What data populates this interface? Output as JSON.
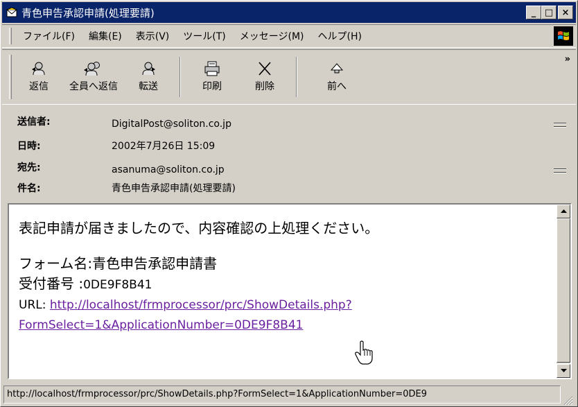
{
  "window": {
    "title": "青色申告承認申請(処理要請)"
  },
  "window_buttons": {
    "minimize": "_",
    "maximize": "□",
    "close": "×"
  },
  "menu": [
    "ファイル(F)",
    "編集(E)",
    "表示(V)",
    "ツール(T)",
    "メッセージ(M)",
    "ヘルプ(H)"
  ],
  "toolbar": {
    "reply": "返信",
    "reply_all": "全員へ返信",
    "forward": "転送",
    "print": "印刷",
    "delete": "削除",
    "previous": "前へ",
    "more": "»"
  },
  "headers": {
    "from_label": "送信者:",
    "from": "DigitalPost@soliton.co.jp",
    "date_label": "日時:",
    "date": "2002年7月26日 15:09",
    "to_label": "宛先:",
    "to": "asanuma@soliton.co.jp",
    "subject_label": "件名:",
    "subject": "青色申告承認申請(処理要請)"
  },
  "body": {
    "line1": "表記申請が届きましたので、内容確認の上処理ください。",
    "form_label": "フォーム名:",
    "form_value": "青色申告承認申請書",
    "receipt_label": "受付番号 :",
    "receipt_value": "0DE9F8B41",
    "url_label": "URL:",
    "url_line1": "http://localhost/frmprocessor/prc/ShowDetails.php?",
    "url_line2": "FormSelect=1&ApplicationNumber=0DE9F8B41"
  },
  "status": {
    "text": "http://localhost/frmprocessor/prc/ShowDetails.php?FormSelect=1&ApplicationNumber=0DE9"
  },
  "colors": {
    "titlebar": "#0a246a",
    "link": "#6a1fa0",
    "chrome": "#d4d0c8"
  }
}
